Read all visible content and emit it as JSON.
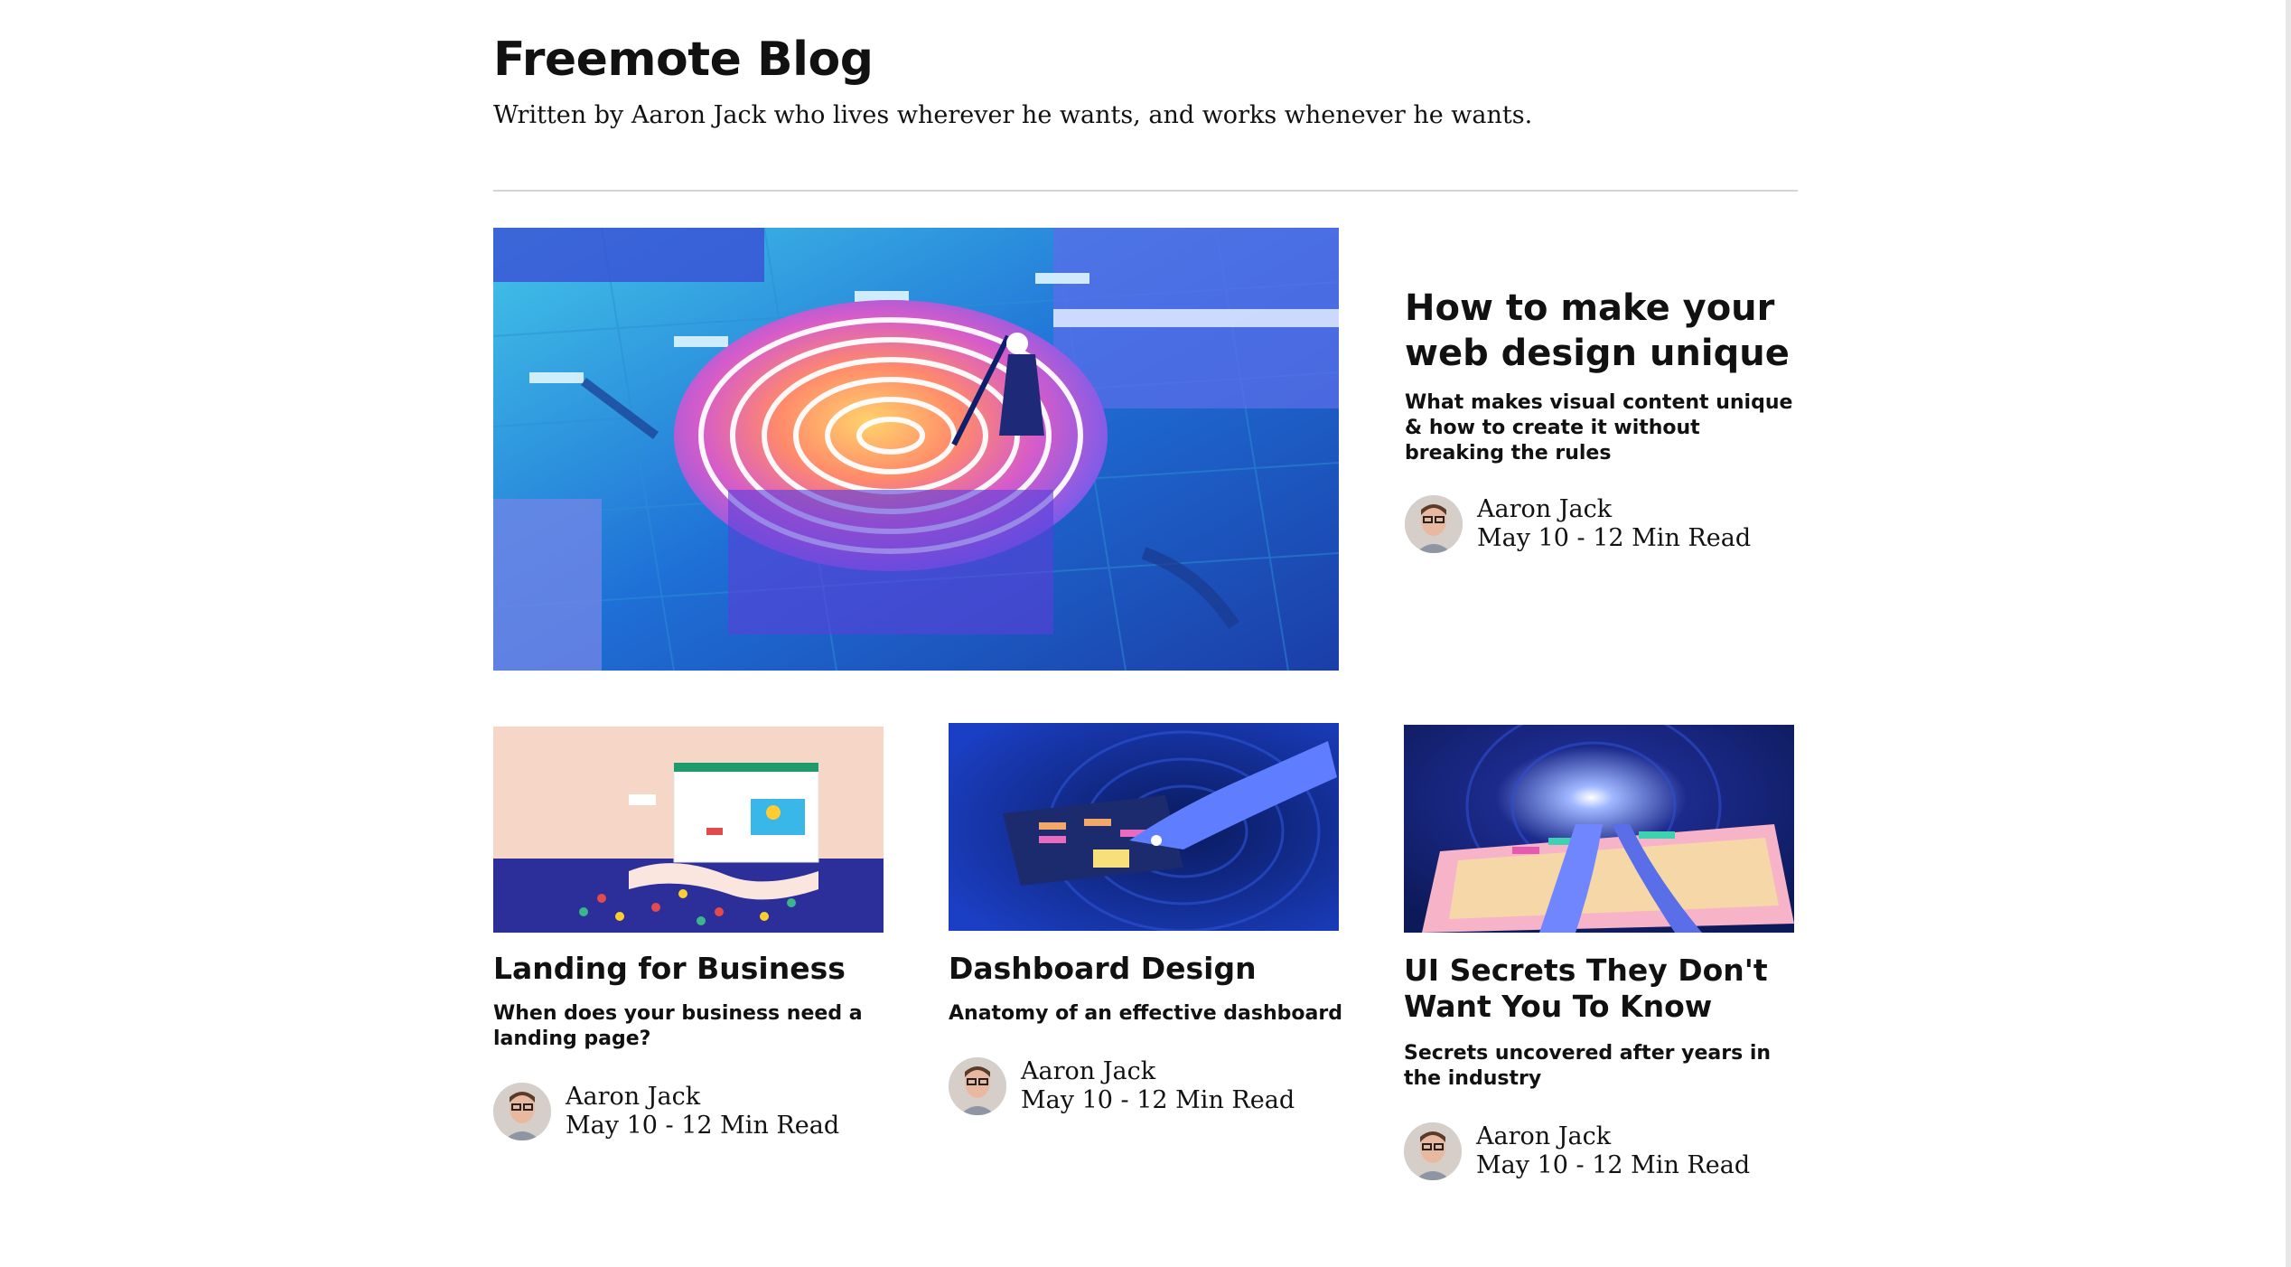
{
  "header": {
    "title": "Freemote Blog",
    "subtitle": "Written by Aaron Jack who lives wherever he wants, and works whenever he wants."
  },
  "featured": {
    "title": "How to make your web design unique",
    "subtitle": "What makes visual content unique & how to create it without breaking the rules",
    "author": "Aaron Jack",
    "meta": "May 10 - 12 Min Read",
    "image_icon": "fingerprint-pool-illustration"
  },
  "posts": [
    {
      "title": "Landing for Business",
      "subtitle": "When does your business need a landing page?",
      "author": "Aaron Jack",
      "meta": "May 10 - 12 Min Read",
      "image_icon": "landing-page-illustration"
    },
    {
      "title": "Dashboard Design",
      "subtitle": "Anatomy of an effective dashboard",
      "author": "Aaron Jack",
      "meta": "May 10 - 12 Min Read",
      "image_icon": "dashboard-tablet-illustration"
    },
    {
      "title": "UI Secrets They Don't Want You To Know",
      "subtitle": "Secrets uncovered after years in the industry",
      "author": "Aaron Jack",
      "meta": "May 10 - 12 Min Read",
      "image_icon": "ui-secrets-illustration"
    }
  ],
  "colors": {
    "text": "#111111",
    "divider": "#d4d4d4",
    "background": "#ffffff"
  }
}
